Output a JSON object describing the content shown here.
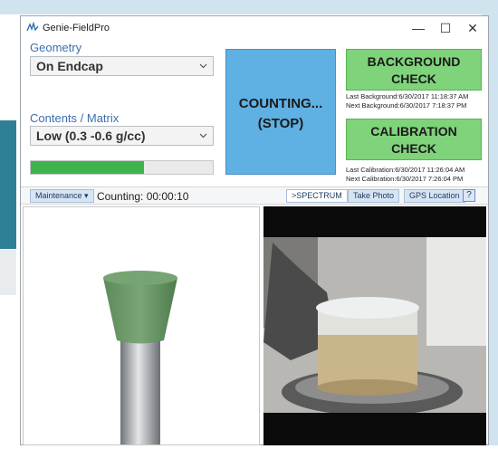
{
  "window": {
    "title": "Genie-FieldPro",
    "minimize": "—",
    "maximize": "☐",
    "close": "✕"
  },
  "geometry": {
    "label": "Geometry",
    "selected": "On Endcap"
  },
  "contents": {
    "label": "Contents / Matrix",
    "selected": "Low (0.3 -0.6 g/cc)"
  },
  "progress": {
    "fraction": 0.62,
    "color": "#3cb44b"
  },
  "counting_button": {
    "line1": "COUNTING...",
    "line2": "(STOP)",
    "color": "#5fb0e3"
  },
  "background_check": {
    "line1": "BACKGROUND",
    "line2": "CHECK",
    "last": "Last Background:6/30/2017 11:18:37 AM",
    "next": "Next Background:6/30/2017 7:18:37 PM"
  },
  "calibration_check": {
    "line1": "CALIBRATION",
    "line2": "CHECK",
    "last": "Last Calibration:6/30/2017 11:26:04 AM",
    "next": "Next Calibration:6/30/2017 7:26:04 PM"
  },
  "toolbar": {
    "maintenance": "Maintenance ▾",
    "counting": "Counting: 00:00:10",
    "spectrum": ">SPECTRUM",
    "take_photo": "Take Photo",
    "gps": "GPS Location",
    "help": "?"
  },
  "icons": {
    "app": "genie-fieldpro-icon",
    "chevron": "chevron-down-icon"
  }
}
